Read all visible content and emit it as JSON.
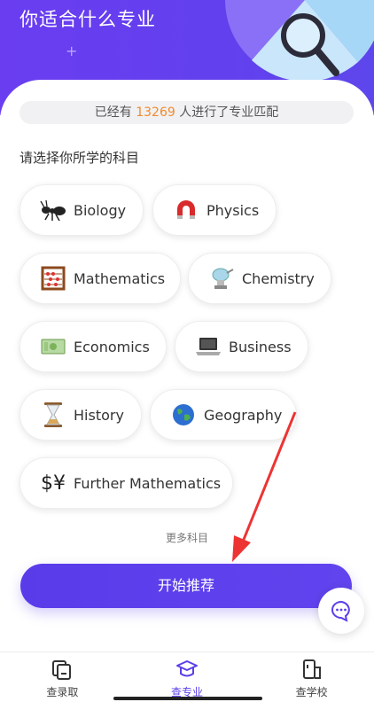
{
  "header": {
    "title": "你适合什么专业",
    "plus": "+"
  },
  "stats": {
    "prefix": "已经有",
    "count": "13269",
    "suffix": "人进行了专业匹配"
  },
  "prompt": "请选择你所学的科目",
  "subjects": [
    {
      "label": "Biology",
      "icon": "ant-icon"
    },
    {
      "label": "Physics",
      "icon": "magnet-icon"
    },
    {
      "label": "Mathematics",
      "icon": "abacus-icon"
    },
    {
      "label": "Chemistry",
      "icon": "alembic-icon"
    },
    {
      "label": "Economics",
      "icon": "money-icon"
    },
    {
      "label": "Business",
      "icon": "laptop-icon"
    },
    {
      "label": "History",
      "icon": "hourglass-icon"
    },
    {
      "label": "Geography",
      "icon": "globe-icon"
    },
    {
      "label": "Further Mathematics",
      "icon": "currency-exchange-icon"
    }
  ],
  "more_label": "更多科目",
  "start_label": "开始推荐",
  "nav": [
    {
      "label": "查录取",
      "icon": "admission-icon"
    },
    {
      "label": "查专业",
      "icon": "graduation-cap-icon"
    },
    {
      "label": "查学校",
      "icon": "school-icon"
    }
  ],
  "colors": {
    "primary": "#5b3fe9",
    "count_highlight": "#f28a2c",
    "arrow": "#ee3333"
  }
}
